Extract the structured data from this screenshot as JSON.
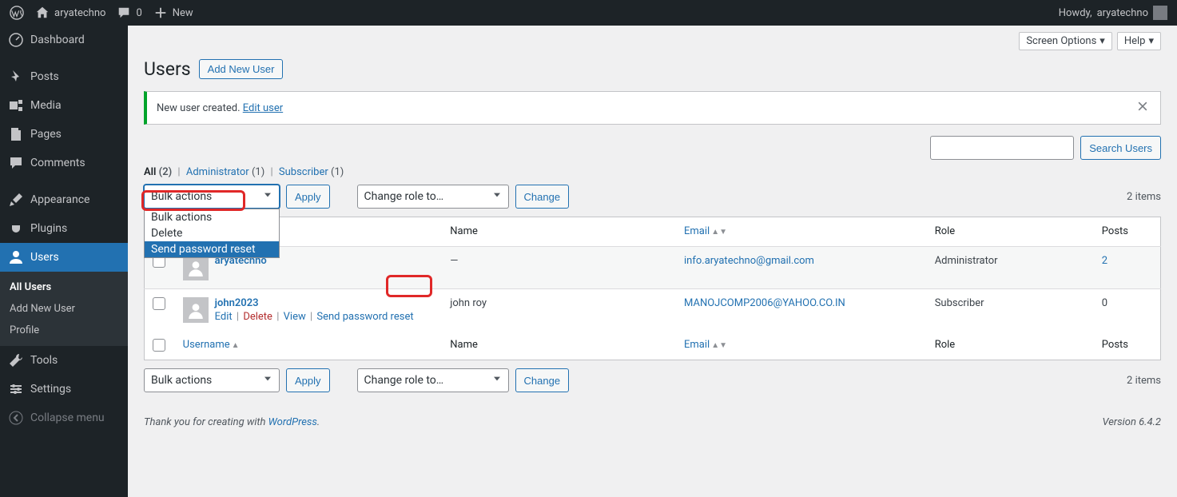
{
  "adminbar": {
    "site_name": "aryatechno",
    "comments_count": "0",
    "new_label": "New",
    "howdy_prefix": "Howdy, ",
    "howdy_name": "aryatechno"
  },
  "sidebar": {
    "items": [
      {
        "label": "Dashboard"
      },
      {
        "label": "Posts"
      },
      {
        "label": "Media"
      },
      {
        "label": "Pages"
      },
      {
        "label": "Comments"
      },
      {
        "label": "Appearance"
      },
      {
        "label": "Plugins"
      },
      {
        "label": "Users",
        "current": true
      },
      {
        "label": "Tools"
      },
      {
        "label": "Settings"
      },
      {
        "label": "Collapse menu"
      }
    ],
    "submenu": [
      {
        "label": "All Users",
        "current": true
      },
      {
        "label": "Add New User"
      },
      {
        "label": "Profile"
      }
    ]
  },
  "screen": {
    "options_label": "Screen Options",
    "help_label": "Help"
  },
  "page": {
    "title": "Users",
    "add_new_label": "Add New User"
  },
  "notice": {
    "text": "New user created. ",
    "link": "Edit user"
  },
  "filters": {
    "all_label": "All",
    "all_count": "(2)",
    "admin_label": "Administrator",
    "admin_count": "(1)",
    "sub_label": "Subscriber",
    "sub_count": "(1)"
  },
  "bulk": {
    "selected": "Bulk actions",
    "options": [
      "Bulk actions",
      "Delete",
      "Send password reset"
    ],
    "apply": "Apply"
  },
  "role_change": {
    "placeholder": "Change role to…",
    "button": "Change"
  },
  "search": {
    "button": "Search Users"
  },
  "items_count": "2 items",
  "columns": {
    "username": "Username",
    "name": "Name",
    "email": "Email",
    "role": "Role",
    "posts": "Posts"
  },
  "rows": [
    {
      "username": "aryatechno",
      "name": "—",
      "email": "info.aryatechno@gmail.com",
      "role": "Administrator",
      "posts": "2"
    },
    {
      "username": "john2023",
      "name": "john roy",
      "email": "MANOJCOMP2006@YAHOO.CO.IN",
      "role": "Subscriber",
      "posts": "0",
      "actions": {
        "edit": "Edit",
        "delete": "Delete",
        "view": "View",
        "send_reset": "Send password reset"
      }
    }
  ],
  "footer": {
    "thanks": "Thank you for creating with ",
    "wp_link": "WordPress",
    "version": "Version 6.4.2"
  }
}
